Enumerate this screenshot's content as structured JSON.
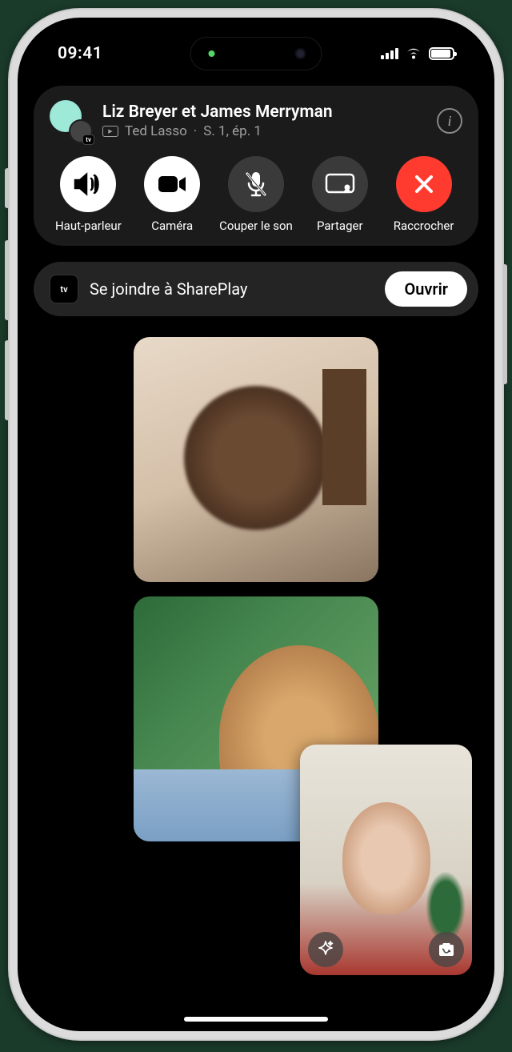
{
  "status": {
    "time": "09:41"
  },
  "call": {
    "title": "Liz Breyer et James Merryman",
    "subtitle_show": "Ted Lasso",
    "subtitle_episode": "S. 1, ép. 1"
  },
  "controls": {
    "speaker": "Haut-parleur",
    "camera": "Caméra",
    "mute": "Couper le son",
    "share": "Partager",
    "end": "Raccrocher"
  },
  "shareplay": {
    "text": "Se joindre à SharePlay",
    "button": "Ouvrir",
    "app_logo": "tv"
  }
}
